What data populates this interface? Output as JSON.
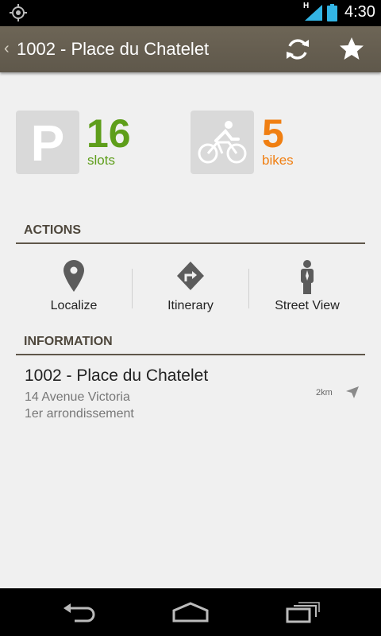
{
  "status_bar": {
    "time": "4:30",
    "network_type": "H",
    "icons": [
      "gps-icon",
      "signal-icon",
      "battery-icon"
    ]
  },
  "action_bar": {
    "title": "1002 - Place du Chatelet",
    "buttons": [
      "refresh-icon",
      "star-icon"
    ]
  },
  "availability": {
    "slots": {
      "count": "16",
      "label": "slots",
      "letter": "P",
      "color": "#5e9e1a"
    },
    "bikes": {
      "count": "5",
      "label": "bikes",
      "color": "#f07f12"
    }
  },
  "actions": {
    "header": "ACTIONS",
    "items": [
      {
        "label": "Localize",
        "icon": "map-pin-icon"
      },
      {
        "label": "Itinerary",
        "icon": "directions-icon"
      },
      {
        "label": "Street View",
        "icon": "pegman-icon"
      }
    ]
  },
  "information": {
    "header": "INFORMATION",
    "name": "1002 - Place du Chatelet",
    "address": "14 Avenue Victoria",
    "district": "1er arrondissement",
    "distance": "2km"
  },
  "nav_bar": {
    "buttons": [
      "back-icon",
      "home-icon",
      "recent-apps-icon"
    ]
  }
}
